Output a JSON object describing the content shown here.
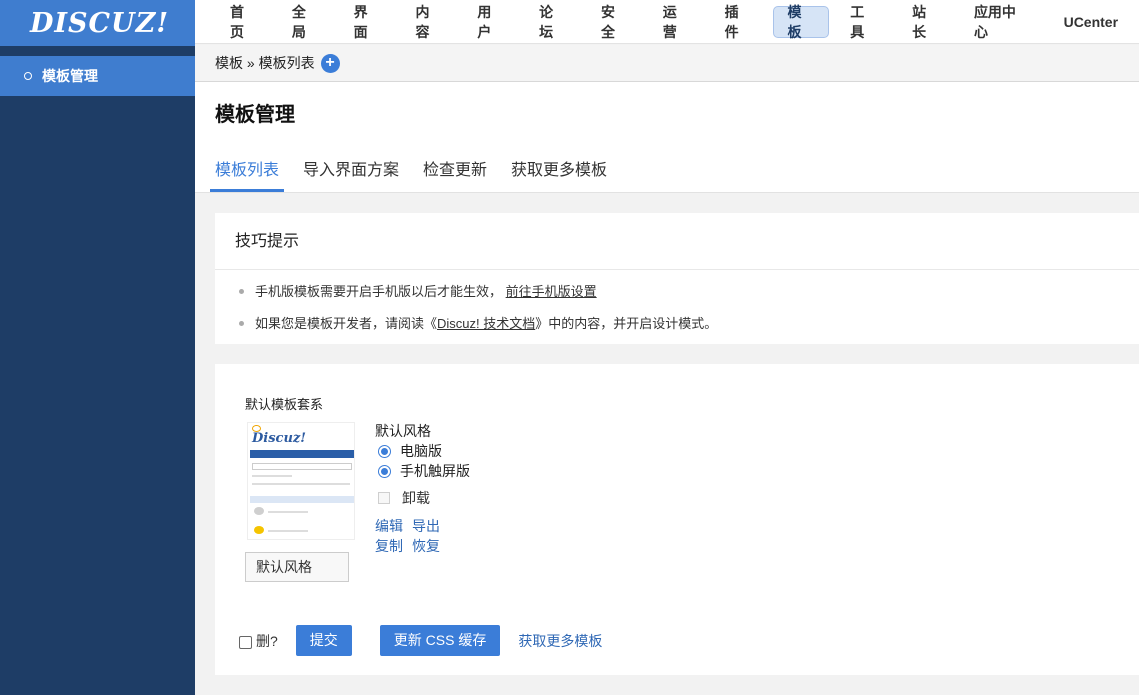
{
  "brand": {
    "logo": "DISCUZ!"
  },
  "sidebar": {
    "items": [
      {
        "label": "模板管理"
      }
    ]
  },
  "topnav": {
    "items": [
      {
        "label": "首页"
      },
      {
        "label": "全局"
      },
      {
        "label": "界面"
      },
      {
        "label": "内容"
      },
      {
        "label": "用户"
      },
      {
        "label": "论坛"
      },
      {
        "label": "安全"
      },
      {
        "label": "运营"
      },
      {
        "label": "插件"
      },
      {
        "label": "模板"
      },
      {
        "label": "工具"
      },
      {
        "label": "站长"
      },
      {
        "label": "应用中心"
      },
      {
        "label": "UCenter"
      }
    ],
    "active": "模板"
  },
  "breadcrumb": {
    "text": "模板 » 模板列表"
  },
  "page": {
    "title": "模板管理",
    "tabs": [
      {
        "label": "模板列表"
      },
      {
        "label": "导入界面方案"
      },
      {
        "label": "检查更新"
      },
      {
        "label": "获取更多模板"
      }
    ]
  },
  "tips": {
    "title": "技巧提示",
    "line1_text": "手机版模板需要开启手机版以后才能生效，",
    "line1_link": "前往手机版设置",
    "line2_prefix": "如果您是模板开发者，请阅读《",
    "line2_link": "Discuz! 技术文档",
    "line2_suffix": "》中的内容，并开启设计模式。"
  },
  "template": {
    "suite_title": "默认模板套系",
    "style_name": "默认风格",
    "style_label": "默认风格",
    "options": {
      "pc": "电脑版",
      "mobile": "手机触屏版",
      "uninstall": "卸载"
    },
    "links": {
      "edit": "编辑",
      "export": "导出",
      "copy": "复制",
      "restore": "恢复"
    }
  },
  "actions": {
    "delete_label": "删?",
    "submit": "提交",
    "update_css": "更新 CSS 缓存",
    "more": "获取更多模板"
  }
}
